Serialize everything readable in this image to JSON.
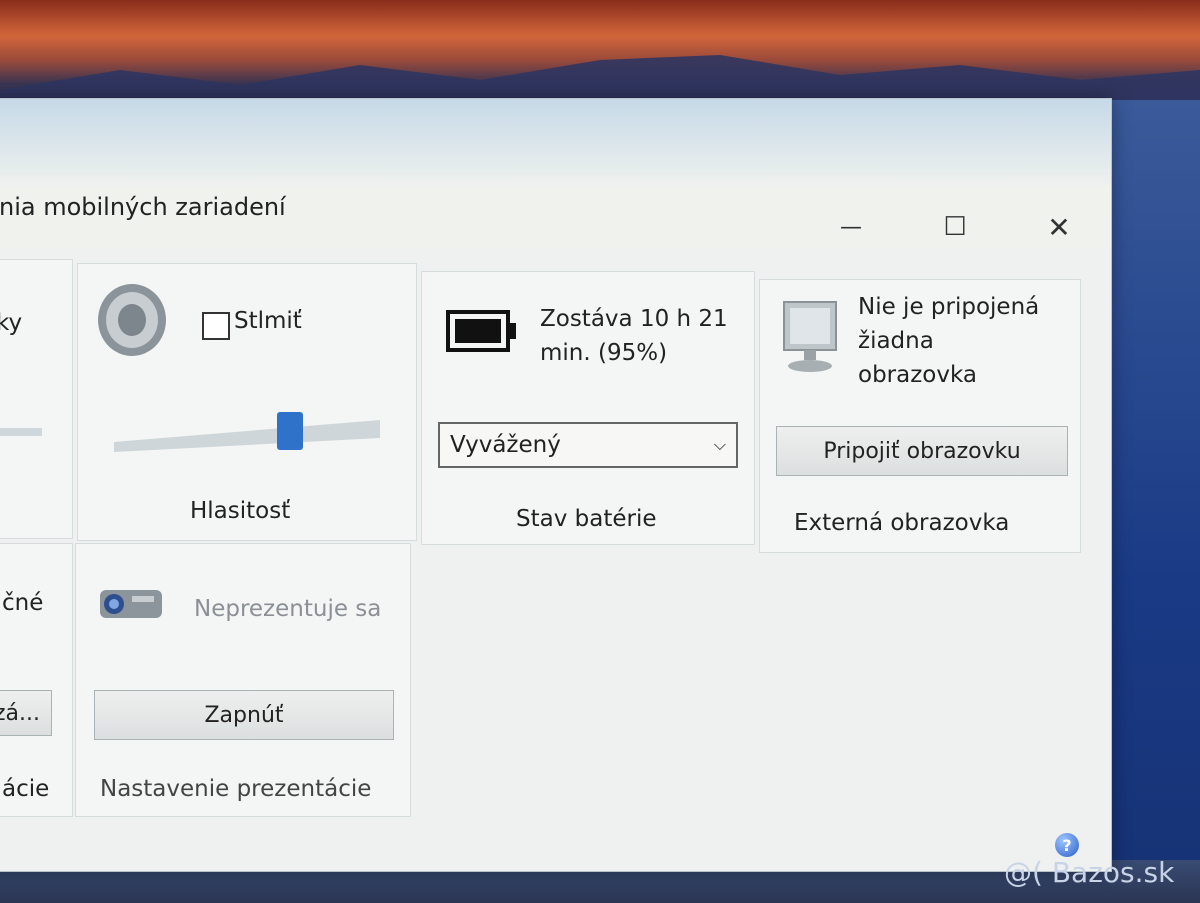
{
  "window": {
    "title": "nia mobilných zariadení",
    "controls": {
      "minimize": "—",
      "maximize": "☐",
      "close": "✕"
    }
  },
  "left_partial": {
    "top_fragment": "ky",
    "mid_fragment": "čné",
    "button_fragment": "zá...",
    "bottom_fragment": "ácie"
  },
  "volume": {
    "mute_label": "Stlmiť",
    "mute_checked": false,
    "level": 0.68,
    "footer": "Hlasitosť"
  },
  "battery": {
    "status_line1": "Zostáva 10 h 21",
    "status_line2": "min. (95%)",
    "charge_percent": 95,
    "plan_selected": "Vyvážený",
    "footer": "Stav batérie"
  },
  "display": {
    "status_line1": "Nie je pripojená",
    "status_line2": "žiadna",
    "status_line3": "obrazovka",
    "button": "Pripojiť obrazovku",
    "footer": "Externá obrazovka"
  },
  "presentation": {
    "status": "Neprezentuje sa",
    "button": "Zapnúť",
    "footer": "Nastavenie prezentácie"
  },
  "help_icon": "?",
  "watermark": "@( Bazos.sk"
}
